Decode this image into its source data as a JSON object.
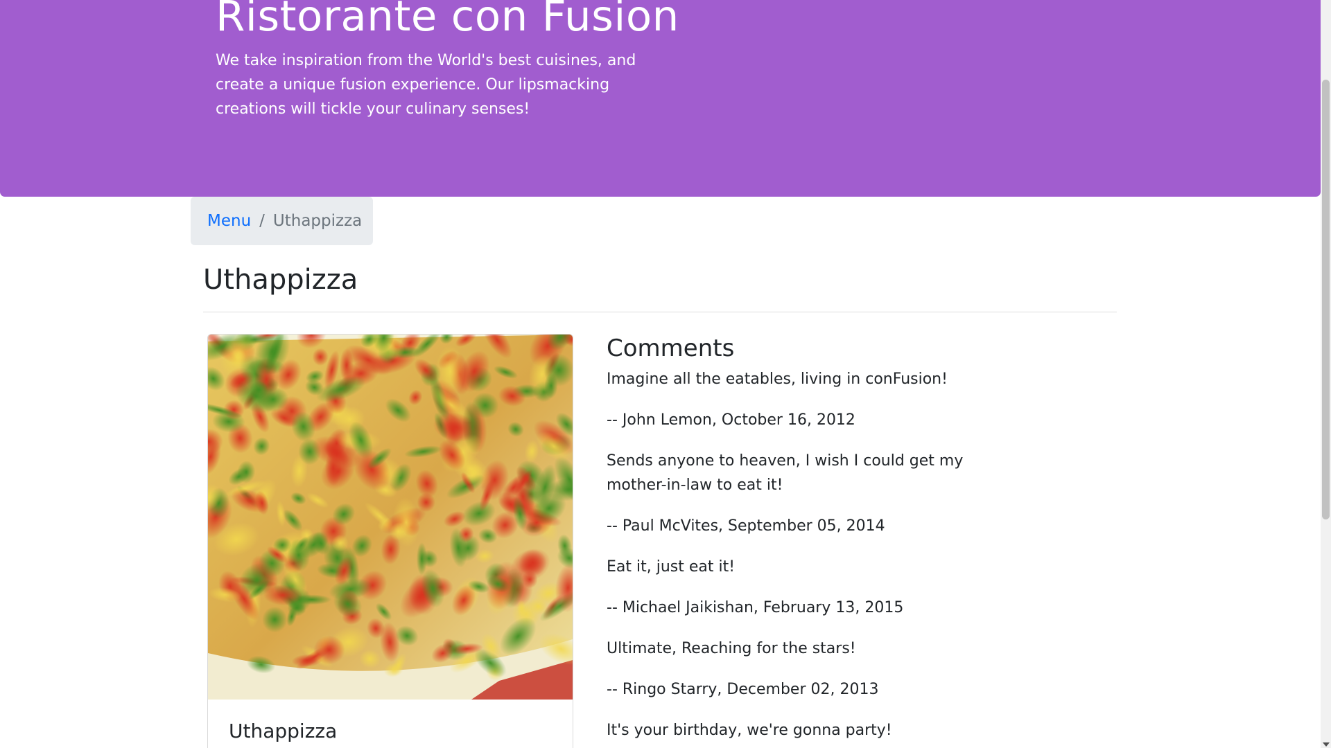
{
  "jumbotron": {
    "title": "Ristorante con Fusion",
    "text": "We take inspiration from the World's best cuisines, and create a unique fusion experience. Our lipsmacking creations will tickle your culinary senses!"
  },
  "breadcrumb": {
    "link_label": "Menu",
    "separator": "/",
    "active_label": "Uthappizza"
  },
  "page": {
    "title": "Uthappizza"
  },
  "dish": {
    "name": "Uthappizza",
    "image": {
      "alt": "Uthappizza",
      "colors": {
        "crust": "#f3e9a6",
        "tomato": "#d9331f",
        "pepper": "#4d9a2a",
        "cheese": "#f0d75a"
      }
    }
  },
  "comments": {
    "heading": "Comments",
    "items": [
      {
        "text": "Imagine all the eatables, living in conFusion!",
        "meta": "-- John Lemon,  October 16, 2012"
      },
      {
        "text": "Sends anyone to heaven, I wish I could get my mother-in-law to eat it!",
        "meta": "-- Paul McVites,  September 05, 2014"
      },
      {
        "text": "Eat it, just eat it!",
        "meta": "-- Michael Jaikishan,  February 13, 2015"
      },
      {
        "text": "Ultimate, Reaching for the stars!",
        "meta": "-- Ringo Starry,  December 02, 2013"
      },
      {
        "text": "It's your birthday, we're gonna party!",
        "meta": ""
      }
    ]
  },
  "theme": {
    "jumbotron_bg": "#a15dcf",
    "link_color": "#0d6efd",
    "breadcrumb_bg": "#e9ecef"
  }
}
